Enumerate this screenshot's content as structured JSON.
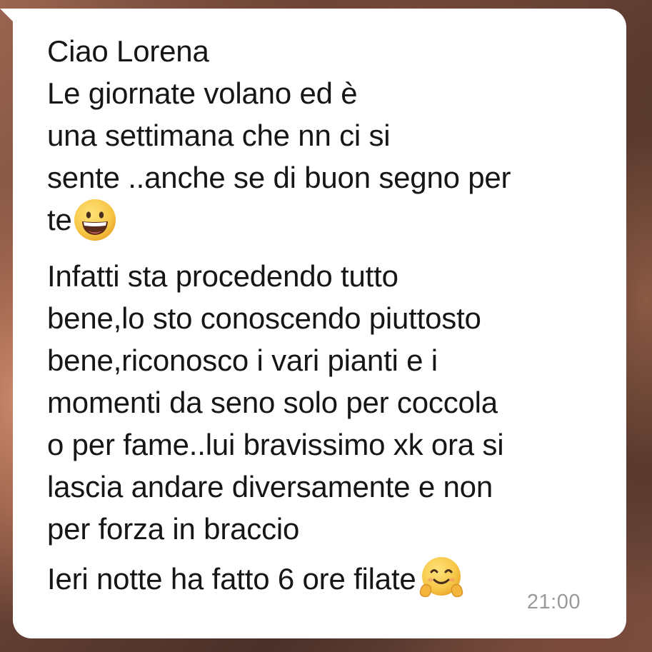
{
  "message": {
    "lines": [
      "Ciao Lorena",
      "Le giornate volano ed è",
      "una settimana che nn ci si",
      "sente ..anche se di buon segno per",
      "te",
      "Infatti sta procedendo tutto",
      "bene,lo sto conoscendo piuttosto",
      "bene,riconosco i vari pianti e i",
      "momenti da seno solo per coccola",
      "o per fame..lui bravissimo xk ora si",
      "lascia andare diversamente e non",
      "per forza in braccio",
      "Ieri notte ha fatto 6 ore filate"
    ],
    "emojis": [
      "grinning-face-icon",
      "hugging-face-icon"
    ],
    "time": "21:00"
  },
  "colors": {
    "bubble": "#ffffff",
    "text": "#161616",
    "time": "#9a9a9a",
    "emoji_face": "#f6c443"
  }
}
